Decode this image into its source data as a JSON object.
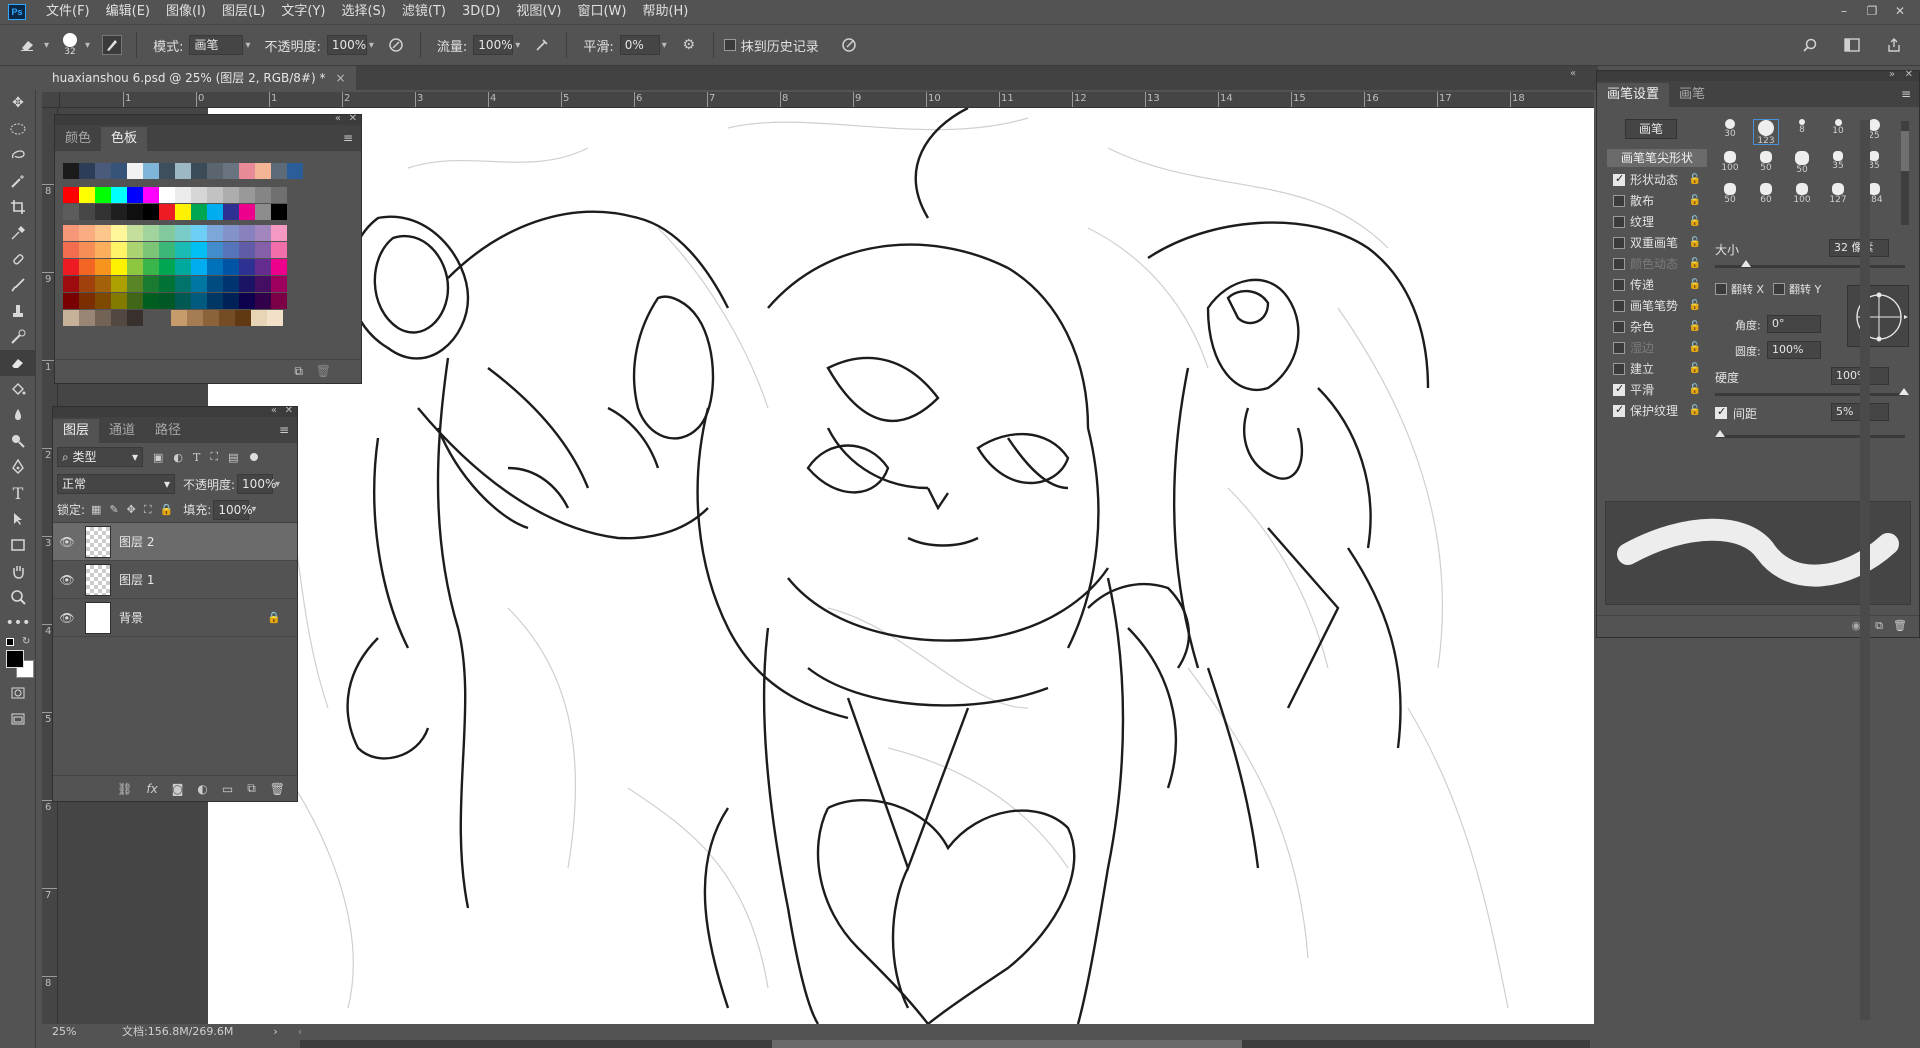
{
  "app": {
    "logo": "Ps"
  },
  "menu": [
    "文件(F)",
    "编辑(E)",
    "图像(I)",
    "图层(L)",
    "文字(Y)",
    "选择(S)",
    "滤镜(T)",
    "3D(D)",
    "视图(V)",
    "窗口(W)",
    "帮助(H)"
  ],
  "window_controls": {
    "minimize": "–",
    "restore": "❐",
    "close": "✕"
  },
  "options": {
    "brush_size": "32",
    "mode_label": "模式:",
    "mode_value": "画笔",
    "opacity_label": "不透明度:",
    "opacity_value": "100%",
    "flow_label": "流量:",
    "flow_value": "100%",
    "smooth_label": "平滑:",
    "smooth_value": "0%",
    "history_label": "抹到历史记录"
  },
  "document": {
    "tab_title": "huaxianshou 6.psd @ 25% (图层 2, RGB/8#) *",
    "zoom": "25%",
    "doc_info": "文档:156.8M/269.6M"
  },
  "rulers": {
    "horizontal": [
      "2",
      "1",
      "0",
      "1",
      "2",
      "3",
      "4",
      "5",
      "6",
      "7",
      "8",
      "9",
      "10",
      "11",
      "12",
      "13",
      "14",
      "15",
      "16",
      "17",
      "18"
    ],
    "vertical": [
      "7",
      "8",
      "9",
      "1",
      "2",
      "3",
      "4",
      "5",
      "6",
      "7",
      "8"
    ]
  },
  "swatches_panel": {
    "tabs": [
      "颜色",
      "色板"
    ],
    "active_tab": "色板",
    "recent": [
      "#1b1b1b",
      "#2c3d57",
      "#4a5a7a",
      "#36547a",
      "#f2f2f2",
      "#7fb5d8",
      "#3d4e5c",
      "#9cb8c4",
      "#3b4b57",
      "#5a6570",
      "#6a7380",
      "#e98a98",
      "#f4b496",
      "#5d6b78",
      "#2b5d98"
    ],
    "rows": [
      [
        "#ff0000",
        "#ffff00",
        "#00ff00",
        "#00ffff",
        "#0000ff",
        "#ff00ff",
        "#ffffff",
        "#ebebeb",
        "#d6d6d6",
        "#c2c2c2",
        "#adadad",
        "#999999",
        "#858585",
        "#707070"
      ],
      [
        "#5c5c5c",
        "#474747",
        "#333333",
        "#1f1f1f",
        "#0f0f0f",
        "#000000",
        "#ed1c24",
        "#fff200",
        "#00a651",
        "#00aeef",
        "#2e3192",
        "#ec008c",
        "#8c8c8c",
        "#000000"
      ],
      [
        "#f7977a",
        "#f9ad81",
        "#fdc68a",
        "#fff79a",
        "#c4df9b",
        "#a3d39c",
        "#82ca9d",
        "#7accc8",
        "#6dcff6",
        "#7da7d9",
        "#8393ca",
        "#8781bd",
        "#a187be",
        "#f49ac2"
      ],
      [
        "#f26c4f",
        "#f68e55",
        "#fbaf5c",
        "#fff467",
        "#acd372",
        "#7cc576",
        "#3bb878",
        "#1abbb4",
        "#00bff3",
        "#438ccb",
        "#5574b9",
        "#605ca8",
        "#855fa8",
        "#f06ea9"
      ],
      [
        "#ed1c24",
        "#f26522",
        "#f7941d",
        "#fff200",
        "#8dc73f",
        "#39b54a",
        "#00a651",
        "#00a99d",
        "#00aeef",
        "#0072bc",
        "#0054a6",
        "#2e3192",
        "#662d91",
        "#ec008c"
      ],
      [
        "#9e0b0f",
        "#a0410d",
        "#a3620a",
        "#aba000",
        "#598527",
        "#1a7b30",
        "#007236",
        "#00746b",
        "#0076a3",
        "#004b80",
        "#003471",
        "#1b1464",
        "#440e62",
        "#9e005d"
      ],
      [
        "#790000",
        "#7b2e00",
        "#7d4900",
        "#827b00",
        "#406618",
        "#005e20",
        "#005826",
        "#005952",
        "#005b7f",
        "#003663",
        "#002157",
        "#0d004c",
        "#32004b",
        "#7b0046"
      ],
      [
        "#c7b299",
        "#998675",
        "#736357",
        "#534741",
        "#37302d",
        "#c69c6d",
        "#a67c52",
        "#8c6239",
        "#754c24",
        "#603913",
        "#e8d5b5",
        "#f2e1c8"
      ]
    ]
  },
  "layers_panel": {
    "tabs": [
      "图层",
      "通道",
      "路径"
    ],
    "active_tab": "图层",
    "filter_label": "类型",
    "blend_mode": "正常",
    "opacity_label": "不透明度:",
    "opacity_value": "100%",
    "lock_label": "锁定:",
    "fill_label": "填充:",
    "fill_value": "100%",
    "layers": [
      {
        "name": "图层 2",
        "selected": true,
        "visible": true
      },
      {
        "name": "图层 1",
        "selected": false,
        "visible": true
      },
      {
        "name": "背景",
        "selected": false,
        "visible": true,
        "locked": true
      }
    ]
  },
  "brush_panel": {
    "tabs": [
      "画笔设置",
      "画笔"
    ],
    "active_tab": "画笔设置",
    "brushes_button": "画笔",
    "section_header": "画笔笔尖形状",
    "options": [
      {
        "label": "形状动态",
        "checked": true,
        "enabled": true
      },
      {
        "label": "散布",
        "checked": false,
        "enabled": true
      },
      {
        "label": "纹理",
        "checked": false,
        "enabled": true
      },
      {
        "label": "双重画笔",
        "checked": false,
        "enabled": true
      },
      {
        "label": "颜色动态",
        "checked": false,
        "enabled": false
      },
      {
        "label": "传递",
        "checked": false,
        "enabled": true
      },
      {
        "label": "画笔笔势",
        "checked": false,
        "enabled": true
      },
      {
        "label": "杂色",
        "checked": false,
        "enabled": true
      },
      {
        "label": "湿边",
        "checked": false,
        "enabled": false
      },
      {
        "label": "建立",
        "checked": false,
        "enabled": true
      },
      {
        "label": "平滑",
        "checked": true,
        "enabled": true
      },
      {
        "label": "保护纹理",
        "checked": true,
        "enabled": true
      }
    ],
    "tips": [
      "30",
      "123",
      "8",
      "10",
      "25",
      "100",
      "50",
      "50",
      "35",
      "35",
      "50",
      "60",
      "100",
      "127",
      "284"
    ],
    "size_label": "大小",
    "size_value": "32 像素",
    "flip_x": "翻转 X",
    "flip_y": "翻转 Y",
    "angle_label": "角度:",
    "angle_value": "0°",
    "roundness_label": "圆度:",
    "roundness_value": "100%",
    "hardness_label": "硬度",
    "hardness_value": "100%",
    "spacing_label": "间距",
    "spacing_value": "5%"
  }
}
